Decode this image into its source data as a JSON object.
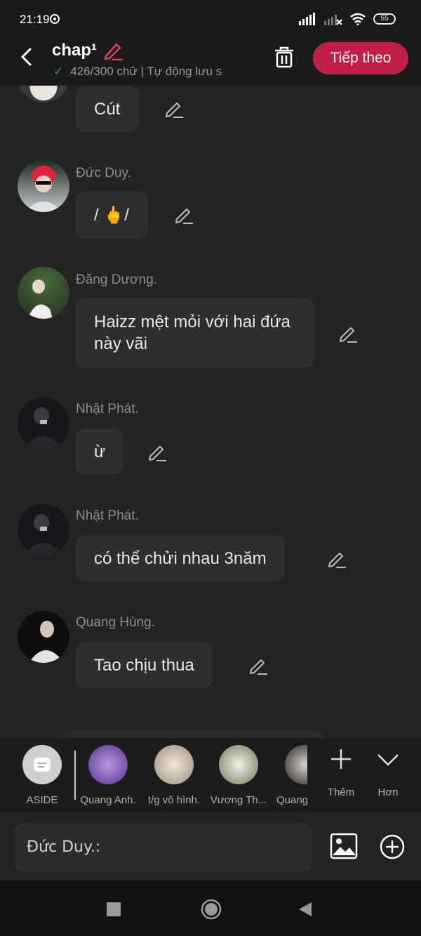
{
  "status_bar": {
    "time": "21:19",
    "battery": "55"
  },
  "header": {
    "title": "chap¹",
    "status": "426/300 chữ | Tự động lưu s",
    "next_label": "Tiếp theo"
  },
  "messages": [
    {
      "name": "",
      "text": "Cút"
    },
    {
      "name": "Đức Duy.",
      "text": "/ 🖕/"
    },
    {
      "name": "Đăng Dương.",
      "text": "Haizz mệt mỏi với hai đứa này vãi"
    },
    {
      "name": "Nhật Phát.",
      "text": "ừ"
    },
    {
      "name": "Nhật Phát.",
      "text": "có thể chửi nhau 3năm"
    },
    {
      "name": "Quang Hùng.",
      "text": "Tao chịu thua"
    }
  ],
  "characters": [
    {
      "label": "ASIDE"
    },
    {
      "label": "Quang Anh."
    },
    {
      "label": "t/g vô hình."
    },
    {
      "label": "Vương Th..."
    },
    {
      "label": "Quang"
    }
  ],
  "more": {
    "add_label": "Thêm",
    "expand_label": "Hơn"
  },
  "input": {
    "value": "Đức Duy.:"
  }
}
